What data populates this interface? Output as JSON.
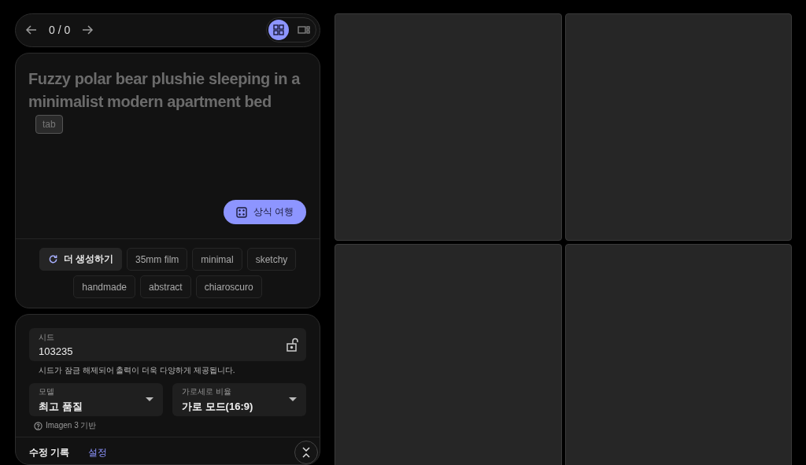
{
  "nav": {
    "counter": "0 / 0",
    "views": [
      {
        "kind": "grid",
        "selected": true
      },
      {
        "kind": "single",
        "selected": false
      }
    ]
  },
  "prompt": {
    "text": "Fuzzy polar bear plushie sleeping in a minimalist modern apartment bed",
    "key_hint": "tab",
    "action": "상식 여행"
  },
  "chips": [
    {
      "kind": "refresh",
      "label": "더 생성하기"
    },
    {
      "kind": "tag",
      "label": "35mm film"
    },
    {
      "kind": "tag",
      "label": "minimal"
    },
    {
      "kind": "tag",
      "label": "sketchy"
    },
    {
      "kind": "tag",
      "label": "handmade"
    },
    {
      "kind": "tag",
      "label": "abstract"
    },
    {
      "kind": "tag",
      "label": "chiaroscuro"
    }
  ],
  "seed": {
    "label": "시드",
    "value": "103235",
    "locked": false,
    "note": "시드가 잠금 해제되어 출력이 더욱 다양하게 제공됩니다."
  },
  "selects": [
    {
      "label": "모델",
      "value": "최고 품질"
    },
    {
      "label": "가로세로 비율",
      "value": "가로 모드(16:9)"
    }
  ],
  "model_note": "Imagen 3 기반",
  "tabs": [
    {
      "label": "수정 기록",
      "selected": false
    },
    {
      "label": "설정",
      "selected": true
    }
  ],
  "images": [
    {
      "kind": "empty"
    },
    {
      "kind": "empty"
    },
    {
      "kind": "empty"
    },
    {
      "kind": "empty"
    }
  ]
}
